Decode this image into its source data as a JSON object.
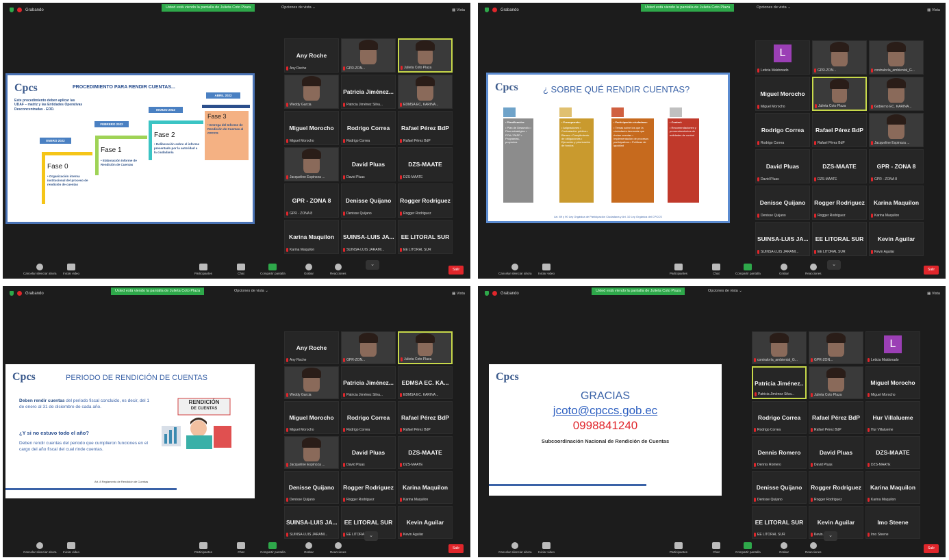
{
  "panels": [
    {
      "recording": "Grabando",
      "banner": "Usted está viendo la pantalla de Julieta Coto Plaza",
      "view_options": "Opciones de vista ⌄",
      "view_btn": "Vista",
      "slide": {
        "logo": "Cpcs",
        "title": "PROCEDIMIENTO PARA RENDIR CUENTAS...",
        "intro": "Este procedimiento deben aplicar las UDAF – matriz y las Entidades Operativas Desconcentradas - EOD.",
        "phases": [
          {
            "tag": "ENERO 2022",
            "name": "Fase 0",
            "desc": "• Organización interna institucional del proceso de rendición de cuentas"
          },
          {
            "tag": "FEBRERO 2022",
            "name": "Fase 1",
            "desc": "• Elaboración informe de Rendición de Cuentas"
          },
          {
            "tag": "MARZO 2022",
            "name": "Fase 2",
            "desc": "• Deliberación sobre el informe presentado por la autoridad a la ciudadanía"
          },
          {
            "tag": "ABRIL 2022",
            "name": "Fase 3",
            "desc": "• Entrega del Informe de Rendición de Cuentas al CPCCS"
          }
        ]
      },
      "tiles": [
        {
          "name": "Any Roche",
          "cap": "Any Roche",
          "type": "name"
        },
        {
          "name": "",
          "cap": "GPR-ZON...",
          "type": "cam"
        },
        {
          "name": "",
          "cap": "Julieta Coto Plaza",
          "type": "cam",
          "hl": true
        },
        {
          "name": "",
          "cap": "Weddy Garcia",
          "type": "cam"
        },
        {
          "name": "Patricia Jiménez...",
          "cap": "Patricia Jiménez Silva...",
          "type": "name"
        },
        {
          "name": "",
          "cap": "EDMSA EC, KARINA...",
          "type": "cam"
        },
        {
          "name": "Miguel Morocho",
          "cap": "Miguel Morocho",
          "type": "name"
        },
        {
          "name": "Rodrigo Correa",
          "cap": "Rodrigo Correa",
          "type": "name"
        },
        {
          "name": "Rafael Pérez BdP",
          "cap": "Rafael Pérez BdP",
          "type": "name"
        },
        {
          "name": "",
          "cap": "Jacqueline Espinoza ...",
          "type": "cam"
        },
        {
          "name": "David Pluas",
          "cap": "David Pluas",
          "type": "name"
        },
        {
          "name": "DZS-MAATE",
          "cap": "DZS-MAATE",
          "type": "name"
        },
        {
          "name": "GPR - ZONA 8",
          "cap": "GPR - ZONA 8",
          "type": "name"
        },
        {
          "name": "Denisse Quijano",
          "cap": "Denisse Quijano",
          "type": "name"
        },
        {
          "name": "Rogger Rodriguez",
          "cap": "Rogger Rodriguez",
          "type": "name"
        },
        {
          "name": "Karina Maquilon",
          "cap": "Karina Maquilon",
          "type": "name"
        },
        {
          "name": "SUINSA-LUIS JA...",
          "cap": "SUINSA-LUIS JARAMI...",
          "type": "name"
        },
        {
          "name": "EE LITORAL SUR",
          "cap": "EE LITORAL SUR",
          "type": "name"
        }
      ],
      "toolbar": [
        "Cancelar silenciar ahora",
        "Iniciar video",
        "Participantes",
        "Chat",
        "Compartir pantalla",
        "Grabar",
        "Reacciones"
      ],
      "participants_count": "30",
      "exit": "Salir"
    },
    {
      "recording": "Grabando",
      "banner": "Usted está viendo la pantalla de Julieta Coto Plaza",
      "view_options": "Opciones de vista ⌄",
      "view_btn": "Vista",
      "slide": {
        "logo": "Cpcs",
        "title": "¿ SOBRE QUÉ RENDIR CUENTAS?",
        "cols": [
          {
            "head": "• Planificación:",
            "body": "• Plan de Desarrollo • Plan estratégico • POA / PAPP • Programas, proyectos",
            "color": "#8c8c8c"
          },
          {
            "head": "• Presupuesto:",
            "body": "• Asignaciones • Contratación pública • Bienes • Cumplimiento de obligaciones • Ejecución y priorización de fondos",
            "color": "#c99a2e"
          },
          {
            "head": "• Participación ciudadana:",
            "body": "• Temas sobre los que la ciudadanía demanda que rindan cuentas • Implementación de procesos participativos • Políticas de igualdad",
            "color": "#c66a1e"
          },
          {
            "head": "• Control:",
            "body": "• Recomendaciones y pronunciamientos de entidades de control",
            "color": "#c0392b"
          }
        ],
        "footer": "Art. 89 y 90 Ley Orgánica de Participación Ciudadana y  Art. 10 Ley Orgánica del CPCCS"
      },
      "tiles": [
        {
          "name": "",
          "cap": "Leticia Maldonado",
          "type": "letter",
          "letter": "L"
        },
        {
          "name": "",
          "cap": "GPR-ZON...",
          "type": "cam"
        },
        {
          "name": "",
          "cap": "contraloría_ambiental_G...",
          "type": "cam"
        },
        {
          "name": "Miguel Morocho",
          "cap": "Miguel Morocho",
          "type": "name"
        },
        {
          "name": "",
          "cap": "Julieta Coto Plaza",
          "type": "cam",
          "hl": true
        },
        {
          "name": "",
          "cap": "Gobierno EC. KARINA...",
          "type": "cam"
        },
        {
          "name": "Rodrigo Correa",
          "cap": "Rodrigo Correa",
          "type": "name"
        },
        {
          "name": "Rafael Pérez BdP",
          "cap": "Rafael Pérez BdP",
          "type": "name"
        },
        {
          "name": "",
          "cap": "Jacqueline Espinoza ...",
          "type": "cam"
        },
        {
          "name": "David Pluas",
          "cap": "David Pluas",
          "type": "name"
        },
        {
          "name": "DZS-MAATE",
          "cap": "DZS-MAATE",
          "type": "name"
        },
        {
          "name": "GPR - ZONA 8",
          "cap": "GPR - ZONA 8",
          "type": "name"
        },
        {
          "name": "Denisse Quijano",
          "cap": "Denisse Quijano",
          "type": "name"
        },
        {
          "name": "Rogger Rodriguez",
          "cap": "Rogger Rodriguez",
          "type": "name"
        },
        {
          "name": "Karina Maquilon",
          "cap": "Karina Maquilon",
          "type": "name"
        },
        {
          "name": "SUINSA-LUIS JA...",
          "cap": "SUINSA-LUIS JARAMI...",
          "type": "name"
        },
        {
          "name": "EE LITORAL SUR",
          "cap": "EE LITORAL SUR",
          "type": "name"
        },
        {
          "name": "Kevin Aguilar",
          "cap": "Kevin Aguilar",
          "type": "name"
        }
      ],
      "toolbar": [
        "Cancelar silenciar ahora",
        "Iniciar video",
        "Participantes",
        "Chat",
        "Compartir pantalla",
        "Grabar",
        "Reacciones"
      ],
      "participants_count": "30",
      "exit": "Salir"
    },
    {
      "recording": "Grabando",
      "banner": "Usted está viendo la pantalla de Julieta Coto Plaza",
      "view_options": "Opciones de vista ⌄",
      "view_btn": "Vista",
      "slide": {
        "logo": "Cpcs",
        "title": "PERIODO DE RENDICIÓN DE CUENTAS",
        "p1_bold": "Deben rendir cuentas",
        "p1_rest": " del periodo fiscal concluido, es decir, del 1 de enero al 31 de diciembre de cada año.",
        "question": "¿Y si no estuvo todo el año?",
        "p2": "Deben rendir cuentas del periodo que cumplieron funciones en el cargo del año fiscal del cual rinde cuentas.",
        "note": "Art. 8 Reglamento de Rendición de Cuentas",
        "art_label_1": "RENDICIÓN",
        "art_label_2": "DE CUENTAS"
      },
      "tiles": [
        {
          "name": "Any Roche",
          "cap": "Any Roche",
          "type": "name"
        },
        {
          "name": "",
          "cap": "GPR-ZON...",
          "type": "cam"
        },
        {
          "name": "",
          "cap": "Julieta Coto Plaza",
          "type": "cam",
          "hl": true
        },
        {
          "name": "",
          "cap": "Weddy Garcia",
          "type": "cam"
        },
        {
          "name": "Patricia Jiménez...",
          "cap": "Patricia Jiménez Silva...",
          "type": "name"
        },
        {
          "name": "EDMSA EC. KA...",
          "cap": "EDMSA EC. KARINA...",
          "type": "name"
        },
        {
          "name": "Miguel Morocho",
          "cap": "Miguel Morocho",
          "type": "name"
        },
        {
          "name": "Rodrigo Correa",
          "cap": "Rodrigo Correa",
          "type": "name"
        },
        {
          "name": "Rafael Pérez BdP",
          "cap": "Rafael Pérez BdP",
          "type": "name"
        },
        {
          "name": "",
          "cap": "Jacqueline Espinoza ...",
          "type": "cam"
        },
        {
          "name": "David Pluas",
          "cap": "David Pluas",
          "type": "name"
        },
        {
          "name": "DZS-MAATE",
          "cap": "DZS-MAATE",
          "type": "name"
        },
        {
          "name": "Denisse Quijano",
          "cap": "Denisse Quijano",
          "type": "name"
        },
        {
          "name": "Rogger Rodriguez",
          "cap": "Rogger Rodriguez",
          "type": "name"
        },
        {
          "name": "Karina Maquilon",
          "cap": "Karina Maquilon",
          "type": "name"
        },
        {
          "name": "SUINSA-LUIS JA...",
          "cap": "SUINSA-LUIS JARAMI...",
          "type": "name"
        },
        {
          "name": "EE LITORAL SUR",
          "cap": "EE LITORAL SUR",
          "type": "name"
        },
        {
          "name": "Kevin Aguilar",
          "cap": "Kevin Aguilar",
          "type": "name"
        }
      ],
      "toolbar": [
        "Cancelar silenciar ahora",
        "Iniciar video",
        "Participantes",
        "Chat",
        "Compartir pantalla",
        "Grabar",
        "Reacciones"
      ],
      "participants_count": "30",
      "exit": "Salir"
    },
    {
      "recording": "Grabando",
      "banner": "Usted está viendo la pantalla de Julieta Coto Plaza",
      "view_options": "Opciones de vista ⌄",
      "view_btn": "Vista",
      "slide": {
        "logo": "Cpcs",
        "thanks": "GRACIAS",
        "email": "jcoto@cpccs.gob.ec",
        "phone": "0998841240",
        "dept": "Subcoordinación Nacional de Rendición de Cuentas"
      },
      "tiles": [
        {
          "name": "",
          "cap": "contraloría_ambiental_G...",
          "type": "cam"
        },
        {
          "name": "",
          "cap": "GPR-ZON...",
          "type": "cam"
        },
        {
          "name": "",
          "cap": "Leticia Maldonado",
          "type": "letter",
          "letter": "L"
        },
        {
          "name": "Patricia Jiménez...",
          "cap": "Patricia Jiménez Silva...",
          "type": "name",
          "hl": true
        },
        {
          "name": "",
          "cap": "Julieta Coto Plaza",
          "type": "cam"
        },
        {
          "name": "Miguel Morocho",
          "cap": "Miguel Morocho",
          "type": "name"
        },
        {
          "name": "Rodrigo Correa",
          "cap": "Rodrigo Correa",
          "type": "name"
        },
        {
          "name": "Rafael Pérez BdP",
          "cap": "Rafael Pérez BdP",
          "type": "name"
        },
        {
          "name": "Hur Villalueme",
          "cap": "Hur Villalueme",
          "type": "name"
        },
        {
          "name": "Dennis Romero",
          "cap": "Dennis Romero",
          "type": "name"
        },
        {
          "name": "David Pluas",
          "cap": "David Pluas",
          "type": "name"
        },
        {
          "name": "DZS-MAATE",
          "cap": "DZS-MAATE",
          "type": "name"
        },
        {
          "name": "Denisse Quijano",
          "cap": "Denisse Quijano",
          "type": "name"
        },
        {
          "name": "Rogger Rodriguez",
          "cap": "Rogger Rodriguez",
          "type": "name"
        },
        {
          "name": "Karina Maquilon",
          "cap": "Karina Maquilon",
          "type": "name"
        },
        {
          "name": "EE LITORAL SUR",
          "cap": "EE LITORAL SUR",
          "type": "name"
        },
        {
          "name": "Kevin Aguilar",
          "cap": "Kevin Aguilar",
          "type": "name"
        },
        {
          "name": "Imo Steene",
          "cap": "Imo Steene",
          "type": "name"
        }
      ],
      "toolbar": [
        "Cancelar silenciar ahora",
        "Iniciar video",
        "Participantes",
        "Chat",
        "Compartir pantalla",
        "Grabar",
        "Reacciones"
      ],
      "participants_count": "30",
      "exit": "Salir"
    }
  ],
  "colors": {
    "meeting_bg": "#1c1c1c",
    "tile_bg": "#262626",
    "share_green": "#2ea84a",
    "record_red": "#e0262b",
    "slide_blue": "#3a62a7",
    "active_speaker": "#c8d94a"
  },
  "icons": [
    "shield-icon",
    "record-icon",
    "view-grid-icon",
    "mic-icon",
    "video-icon",
    "participants-icon",
    "chat-icon",
    "share-screen-icon",
    "record-button-icon",
    "reactions-icon",
    "chevron-down-icon"
  ]
}
